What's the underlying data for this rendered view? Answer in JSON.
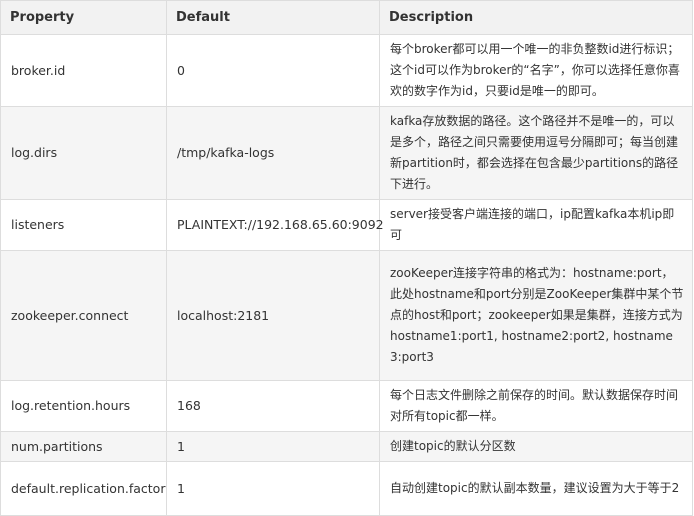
{
  "table": {
    "headers": [
      "Property",
      "Default",
      "Description"
    ],
    "rows": [
      {
        "property": "broker.id",
        "default": "0",
        "description": "每个broker都可以用一个唯一的非负整数id进行标识；这个id可以作为broker的“名字”，你可以选择任意你喜欢的数字作为id，只要id是唯一的即可。"
      },
      {
        "property": "log.dirs",
        "default": "/tmp/kafka-logs",
        "description": "kafka存放数据的路径。这个路径并不是唯一的，可以是多个，路径之间只需要使用逗号分隔即可；每当创建新partition时，都会选择在包含最少partitions的路径下进行。"
      },
      {
        "property": "listeners",
        "default": "PLAINTEXT://192.168.65.60:9092",
        "description": "server接受客户端连接的端口，ip配置kafka本机ip即可"
      },
      {
        "property": "zookeeper.connect",
        "default": "localhost:2181",
        "description": "zooKeeper连接字符串的格式为：hostname:port，此处hostname和port分别是ZooKeeper集群中某个节点的host和port；zookeeper如果是集群，连接方式为 hostname1:port1, hostname2:port2, hostname3:port3"
      },
      {
        "property": "log.retention.hours",
        "default": "168",
        "description": "每个日志文件删除之前保存的时间。默认数据保存时间对所有topic都一样。"
      },
      {
        "property": "num.partitions",
        "default": "1",
        "description": "创建topic的默认分区数"
      },
      {
        "property": "default.replication.factor",
        "default": "1",
        "description": "自动创建topic的默认副本数量，建议设置为大于等于2"
      }
    ]
  }
}
